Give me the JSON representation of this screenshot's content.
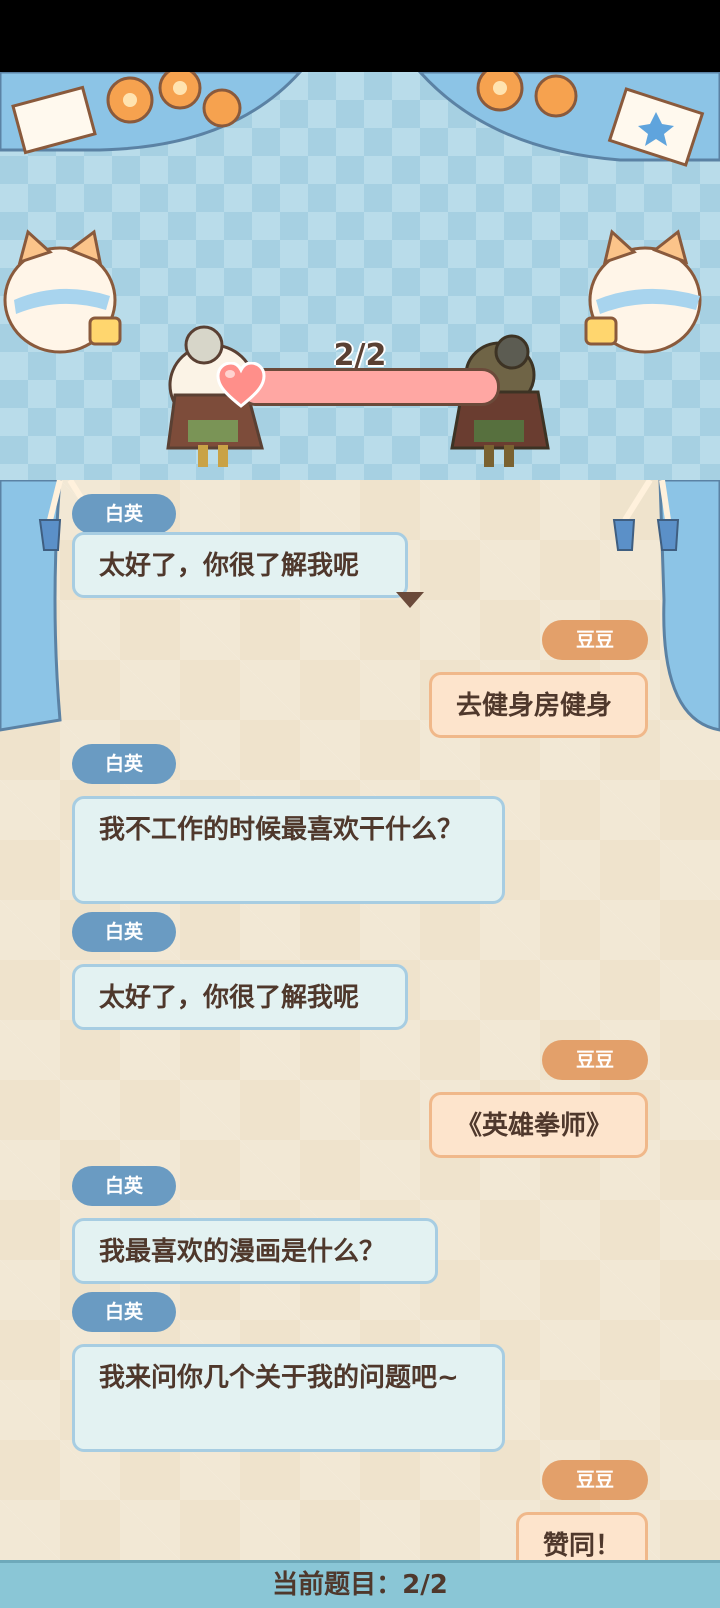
{
  "stage": {
    "progress_text": "2/2",
    "affinity_fraction": 1.0
  },
  "messages": [
    {
      "side": "left",
      "speaker": "白英",
      "text": "太好了，你很了解我呢"
    },
    {
      "side": "right",
      "speaker": "豆豆",
      "text": "去健身房健身"
    },
    {
      "side": "left",
      "speaker": "白英",
      "text": "我不工作的时候最喜欢干什么？"
    },
    {
      "side": "left",
      "speaker": "白英",
      "text": "太好了，你很了解我呢"
    },
    {
      "side": "right",
      "speaker": "豆豆",
      "text": "《英雄拳师》"
    },
    {
      "side": "left",
      "speaker": "白英",
      "text": "我最喜欢的漫画是什么？"
    },
    {
      "side": "left",
      "speaker": "白英",
      "text": "我来问你几个关于我的问题吧~"
    },
    {
      "side": "right",
      "speaker": "豆豆",
      "text": "赞同！"
    }
  ],
  "footer": {
    "label": "当前题目：2/2"
  },
  "colors": {
    "left_tag": "#6a9bc2",
    "right_tag": "#e3a06a",
    "curtain": "#8cc4e6",
    "footer_bg": "#8ac6d6"
  }
}
